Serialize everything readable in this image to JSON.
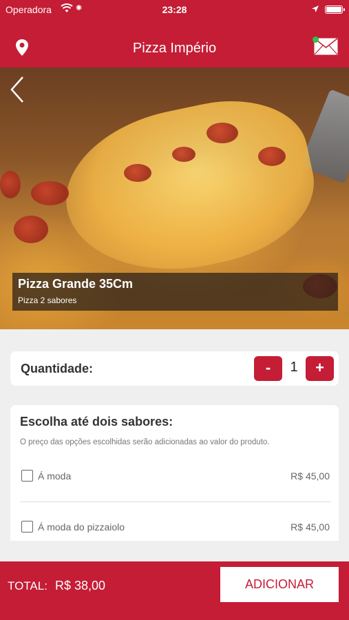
{
  "status_bar": {
    "carrier": "Operadora",
    "time": "23:28",
    "icons": [
      "wifi-icon",
      "activity-spinner-icon",
      "location-arrow-icon",
      "battery-icon"
    ]
  },
  "nav": {
    "title": "Pizza Império",
    "left_icon": "location-pin-icon",
    "right_icon": "mail-icon"
  },
  "product": {
    "name": "Pizza Grande 35Cm",
    "subtitle": "Pizza 2 sabores"
  },
  "quantity": {
    "label": "Quantidade:",
    "value": "1",
    "decrement_label": "-",
    "increment_label": "+"
  },
  "flavors": {
    "heading": "Escolha até dois sabores:",
    "hint": "O preço das opções escolhidas serão adicionadas ao valor do produto.",
    "options": [
      {
        "name": "Á moda",
        "price": "R$ 45,00",
        "checked": false
      },
      {
        "name": "Á moda do pizzaiolo",
        "price": "R$ 45,00",
        "checked": false
      }
    ]
  },
  "footer": {
    "total_label": "TOTAL:",
    "total_value": "R$ 38,00",
    "add_label": "ADICIONAR"
  },
  "colors": {
    "brand": "#c41d35",
    "notification_dot": "#2fc14a"
  }
}
